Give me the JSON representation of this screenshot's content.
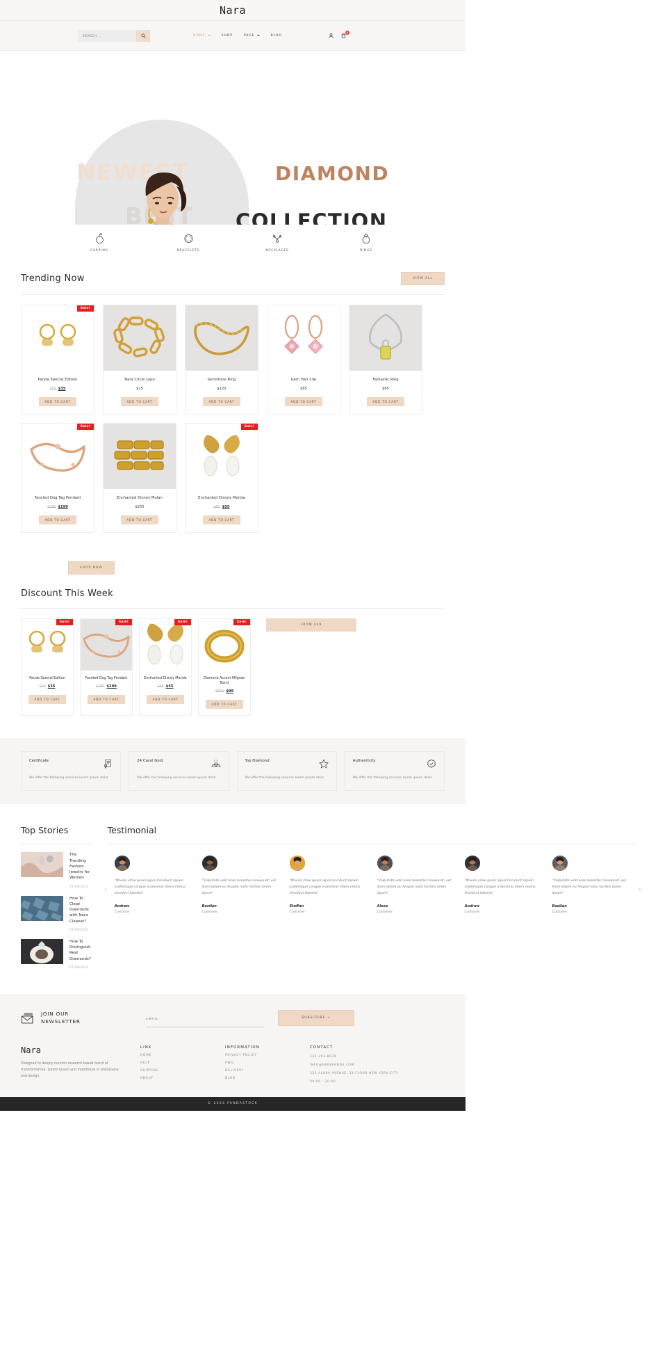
{
  "site": {
    "brand": "Nara",
    "copyright": "© 2024 PANDASTOCK"
  },
  "header": {
    "search_placeholder": "SEARCH...",
    "search_value": "",
    "search_icon": "search-icon",
    "nav": [
      {
        "label": "HOME",
        "has_caret": true,
        "active": true
      },
      {
        "label": "SHOP",
        "has_caret": false,
        "active": false
      },
      {
        "label": "PAGE",
        "has_caret": true,
        "active": false
      },
      {
        "label": "BLOG",
        "has_caret": false,
        "active": false
      }
    ],
    "account_icon": "user-icon",
    "cart_icon": "cart-icon",
    "cart_count": "0"
  },
  "hero": {
    "ghost_newest": "NEWEST",
    "ghost_best": "BEST",
    "title_line1": "DIAMOND",
    "title_line2": "COLLECTION",
    "accent_color": "#bd8460"
  },
  "categories": [
    {
      "label": "EARRING",
      "icon": "earring-icon"
    },
    {
      "label": "BRACELETS",
      "icon": "bracelet-icon"
    },
    {
      "label": "NECKLACES",
      "icon": "necklace-icon"
    },
    {
      "label": "RINGS",
      "icon": "ring-icon"
    }
  ],
  "trending": {
    "title": "Trending Now",
    "view_all": "VIEW ALL",
    "add_to_cart": "ADD TO CART",
    "sale_tag": "Sale!",
    "products": [
      {
        "title": "Panda Special Edition",
        "price_old": "$50",
        "price_new": "$35",
        "sale": true,
        "bg": "white",
        "img": "earrings-butterfly"
      },
      {
        "title": "Nara Circle Lopo",
        "price": "$15",
        "sale": false,
        "bg": "gray",
        "img": "chain-bracelet"
      },
      {
        "title": "Gemstone Ring",
        "price": "$120",
        "sale": false,
        "bg": "gray",
        "img": "gold-chain-necklace"
      },
      {
        "title": "Gem Hair Clip",
        "price": "$65",
        "sale": false,
        "bg": "white",
        "img": "pink-gem-earrings"
      },
      {
        "title": "Fantastic Ring",
        "price": "$45",
        "sale": false,
        "bg": "gray",
        "img": "silver-pendant-necklace"
      },
      {
        "title": "Faceted Dog Tag Pendant",
        "price_old": "$285",
        "price_new": "$199",
        "sale": true,
        "bg": "white",
        "img": "rose-gold-bracelet"
      },
      {
        "title": "Enchanted Disney Mulan",
        "price": "$255",
        "sale": false,
        "bg": "gray",
        "img": "gold-link-ring"
      },
      {
        "title": "Enchanted Disney Merida",
        "price_old": "$65",
        "price_new": "$55",
        "sale": true,
        "bg": "white",
        "img": "pearl-drop-earrings"
      }
    ]
  },
  "shop_now": "SHOP NOW",
  "discount": {
    "title": "Discount This Week",
    "banner": "FROM $49",
    "add_to_cart": "ADD TO CART",
    "sale_tag": "Sale!",
    "products": [
      {
        "title": "Panda Special Edition",
        "price_old": "$50",
        "price_new": "$35",
        "bg": "white",
        "img": "earrings-butterfly"
      },
      {
        "title": "Faceted Dog Tag Pendant",
        "price_old": "$285",
        "price_new": "$199",
        "bg": "gray",
        "img": "rose-gold-bracelet"
      },
      {
        "title": "Enchanted Disney Merida",
        "price_old": "$65",
        "price_new": "$55",
        "bg": "white",
        "img": "pearl-drop-earrings"
      },
      {
        "title": "Diamond Accent Milgrain Band",
        "price_old": "$150",
        "price_new": "$99",
        "bg": "white",
        "img": "gold-band-ring"
      }
    ]
  },
  "features": [
    {
      "title": "Certificate",
      "desc": "We offer the following services lorem ipsum dolor",
      "icon": "certificate-icon"
    },
    {
      "title": "24 Carat Gold",
      "desc": "We offer the following services lorem ipsum dolor",
      "icon": "gold-bars-icon"
    },
    {
      "title": "Top Diamond",
      "desc": "We offer the following services lorem ipsum dolor",
      "icon": "star-icon"
    },
    {
      "title": "Authenticity",
      "desc": "We offer the following services lorem ipsum dolor",
      "icon": "verified-badge-icon"
    }
  ],
  "stories": {
    "title": "Top Stories",
    "items": [
      {
        "title": "The Trending Fashion Jewelry for Women",
        "date": "07/04/2022",
        "thumb": "earring-closeup"
      },
      {
        "title": "How To Clean Diamonds with Nara Cleaner?",
        "date": "07/04/2022",
        "thumb": "blue-gems"
      },
      {
        "title": "How To Distinguish Real Diamonds?",
        "date": "07/04/2022",
        "thumb": "diamond-ring"
      }
    ]
  },
  "testimonial": {
    "title": "Testimonial",
    "prev_icon": "chevron-left-icon",
    "next_icon": "chevron-right-icon",
    "items": [
      {
        "quote": "\"Mauris vitae quam ligula tincidunt sapien scelerisque congue maecenas libero metus tincidunt lobortis\"",
        "name": "Andrew",
        "role": "Customer"
      },
      {
        "quote": "\"Vulputate velit esse molestie consequat, vel illum dolore eu feugiat nulla facilisis lorem ipsum\"",
        "name": "Bastian",
        "role": "Customer"
      },
      {
        "quote": "\"Mauris vitae quam ligula tincidunt sapien scelerisque congue maecenas libero metus tincidunt lobortis\"",
        "name": "Steffan",
        "role": "Customer"
      },
      {
        "quote": "\"Vulputate velit esse molestie consequat, vel illum dolore eu feugiat nulla facilisis lorem ipsum\"",
        "name": "Alexa",
        "role": "Customer"
      },
      {
        "quote": "\"Mauris vitae quam ligula tincidunt sapien scelerisque congue maecenas libero metus tincidunt lobortis\"",
        "name": "Andrew",
        "role": "Customer"
      },
      {
        "quote": "\"Vulputate velit esse molestie consequat, vel illum dolore eu feugiat nulla facilisis lorem ipsum\"",
        "name": "Bastian",
        "role": "Customer"
      }
    ]
  },
  "newsletter": {
    "title_line1": "JOIN OUR",
    "title_line2": "NEWSLETTER",
    "email_placeholder": "EMAIL",
    "email_value": "",
    "subscribe": "SUBSCRIBE  →",
    "icon": "envelope-icon"
  },
  "footer": {
    "brand": "Nara",
    "about": "Designed to deeply nourish research-based blend of transformative. Lorem ipsum and intentional in philosophy and design.",
    "columns": [
      {
        "head": "LINK",
        "links": [
          "HOME",
          "HELP",
          "SHIPPING",
          "ABOUT"
        ]
      },
      {
        "head": "INFORMATION",
        "links": [
          "PRIVACY POLICY",
          "FWQ",
          "DELIVERY",
          "BLOG"
        ]
      }
    ],
    "contact_head": "CONTACT",
    "contact": [
      "330-203-8039",
      "INFO@NARAPANDA.COM",
      "350 ALOKA AVENUE, 34 FLOOR NEW YORK CITY",
      "09:00 : 20:00"
    ]
  }
}
